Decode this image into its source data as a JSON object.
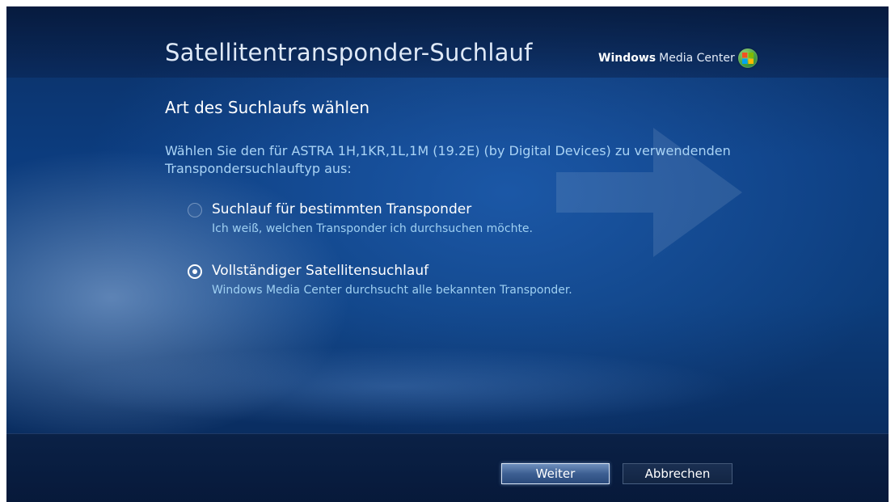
{
  "header": {
    "title": "Satellitentransponder-Suchlauf",
    "brand_bold": "Windows",
    "brand_rest": "Media Center",
    "brand_icon": "windows-orb-icon"
  },
  "main": {
    "subheading": "Art des Suchlaufs wählen",
    "description": "Wählen Sie den für ASTRA 1H,1KR,1L,1M (19.2E) (by Digital Devices) zu verwendenden Transpondersuchlauftyp aus:",
    "options": [
      {
        "label": "Suchlauf für bestimmten Transponder",
        "sublabel": "Ich weiß, welchen Transponder ich durchsuchen möchte.",
        "selected": false
      },
      {
        "label": "Vollständiger Satellitensuchlauf",
        "sublabel": "Windows Media Center durchsucht alle bekannten Transponder.",
        "selected": true
      }
    ]
  },
  "footer": {
    "next_label": "Weiter",
    "cancel_label": "Abbrechen"
  },
  "colors": {
    "background": "#0c3c7e",
    "description_text": "#a9d3f5",
    "button_focus": "#3d5f92"
  }
}
